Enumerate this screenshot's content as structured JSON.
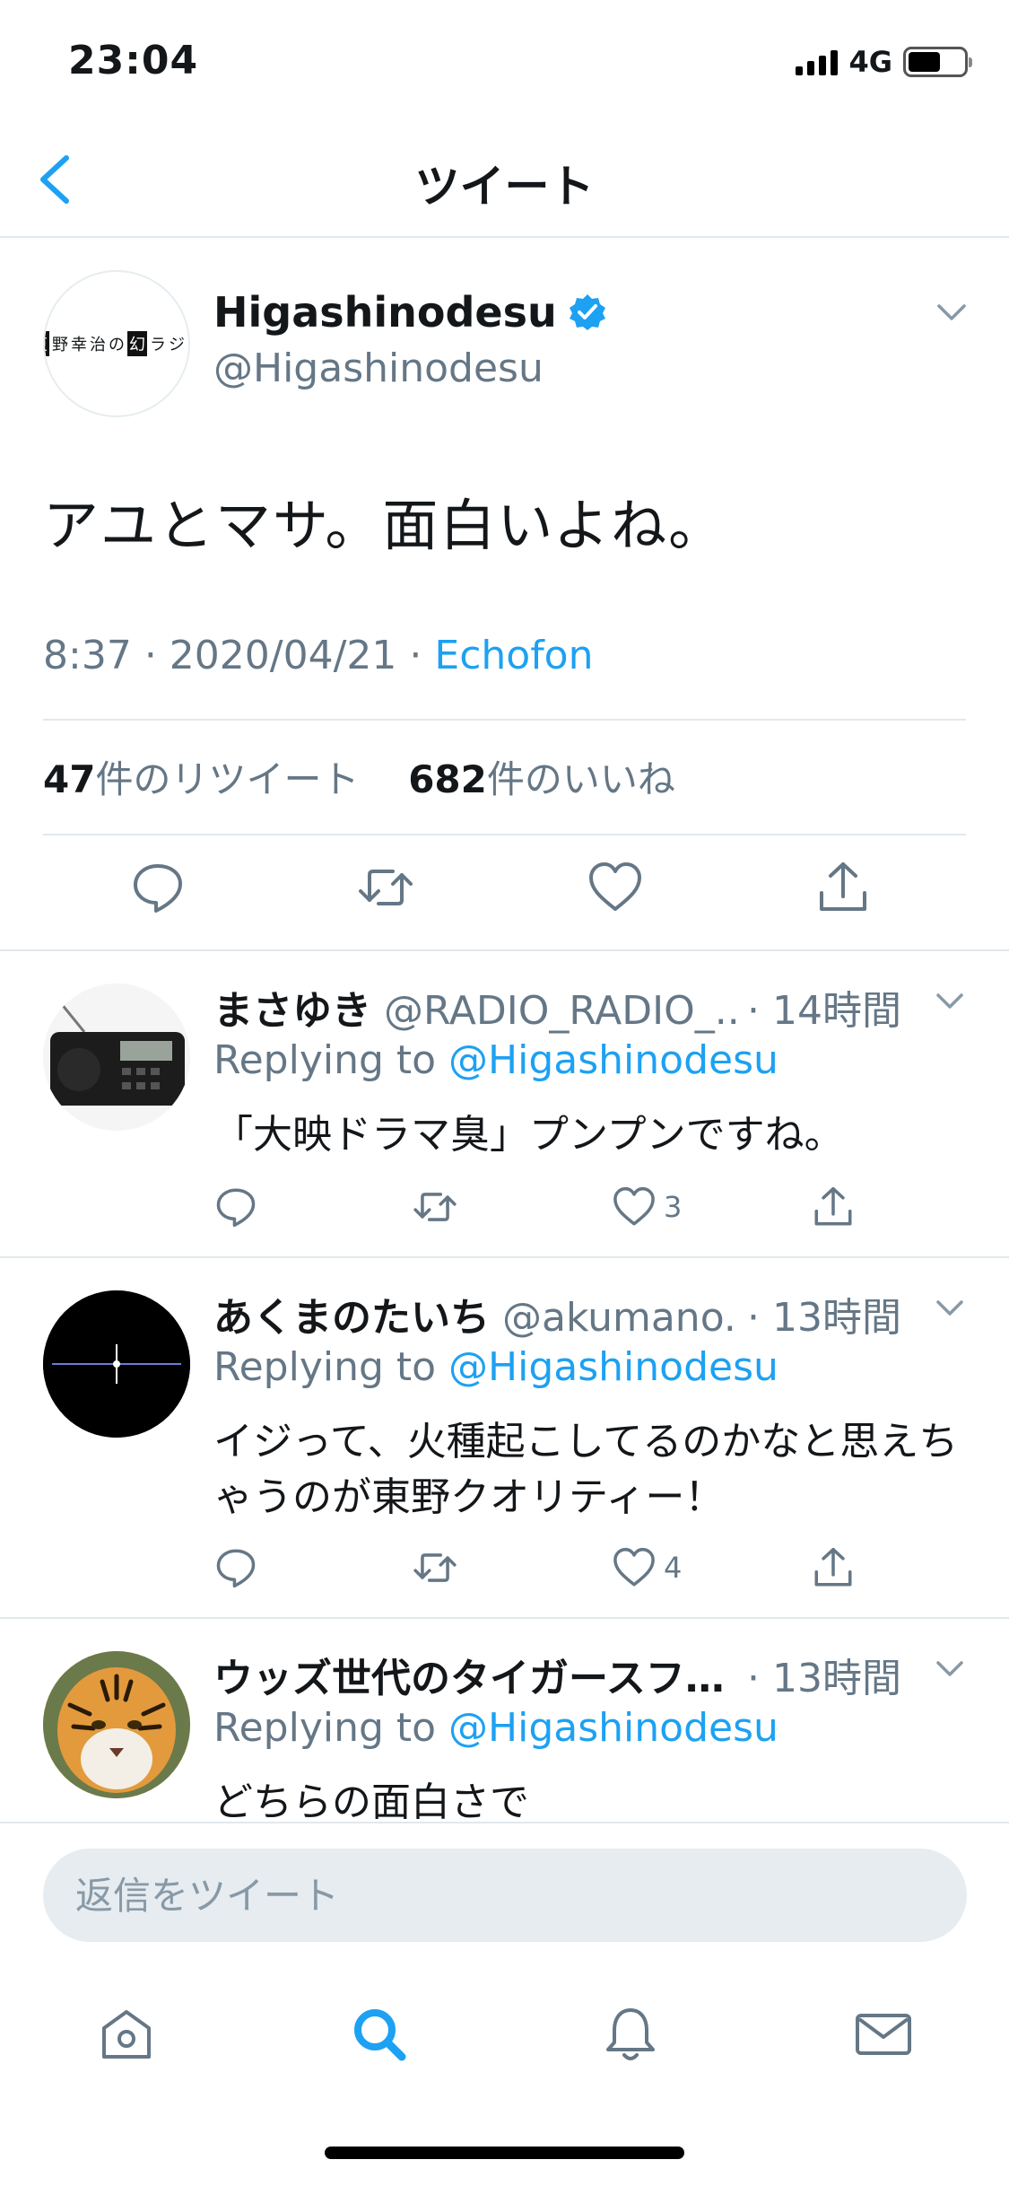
{
  "status_bar": {
    "time": "23:04",
    "network": "4G"
  },
  "nav": {
    "title": "ツイート"
  },
  "tweet": {
    "avatar_text": "東野幸治の幻ラジオ",
    "display_name": "Higashinodesu",
    "handle": "@Higashinodesu",
    "text": "アユとマサ。面白いよね。",
    "time": "8:37",
    "date": "2020/04/21",
    "source": "Echofon",
    "retweets_count": "47",
    "retweets_label": "件のリツイート",
    "likes_count": "682",
    "likes_label": "件のいいね"
  },
  "replies": [
    {
      "name": "まさゆき",
      "handle": "@RADIO_RADIO_...",
      "time": "· 14時間",
      "replying_prefix": "Replying to ",
      "replying_to": "@Higashinodesu",
      "text": "「大映ドラマ臭」プンプンですね。",
      "likes": "3"
    },
    {
      "name": "あくまのたいち",
      "handle": "@akumano...",
      "time": "· 13時間",
      "replying_prefix": "Replying to ",
      "replying_to": "@Higashinodesu",
      "text": "イジって、火種起こしてるのかなと思えちゃうのが東野クオリティー！",
      "likes": "4"
    },
    {
      "name": "ウッズ世代のタイガースフ…",
      "handle": "",
      "time": "· 13時間",
      "replying_prefix": "Replying to ",
      "replying_to": "@Higashinodesu",
      "text": "どちらの面白さで"
    }
  ],
  "composer": {
    "placeholder": "返信をツイート"
  },
  "colors": {
    "accent": "#1da1f2",
    "secondary_text": "#657786",
    "divider": "#e1e8ed"
  },
  "icons": {
    "tabbar": [
      "home-icon",
      "search-icon",
      "notifications-icon",
      "messages-icon"
    ],
    "actions": [
      "reply-icon",
      "retweet-icon",
      "like-icon",
      "share-icon"
    ]
  }
}
